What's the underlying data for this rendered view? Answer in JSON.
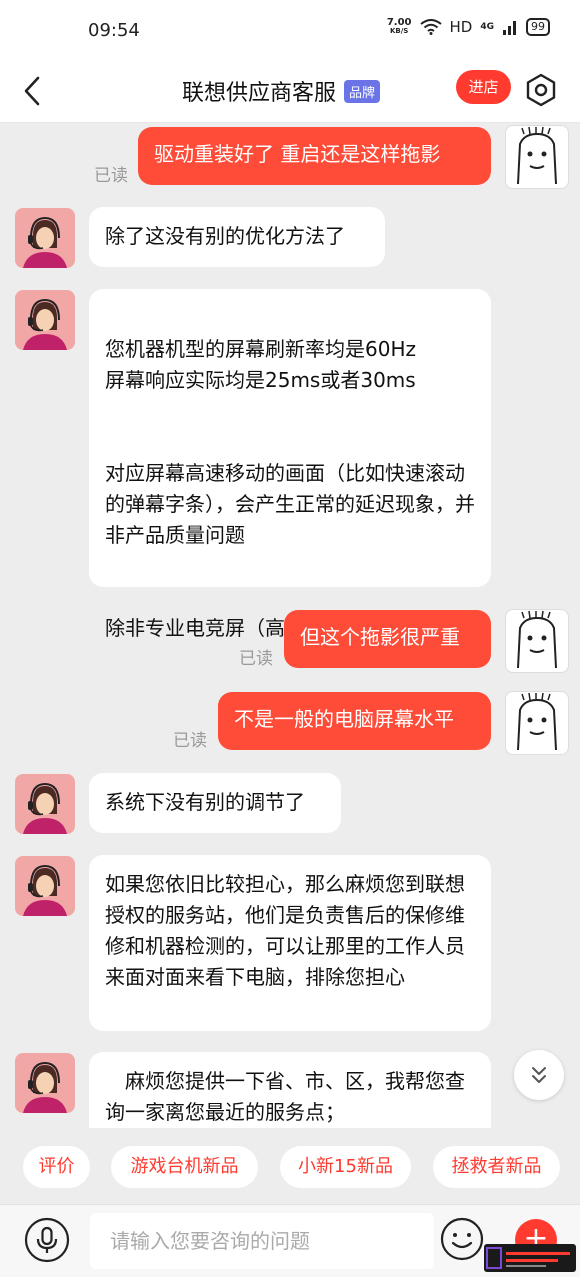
{
  "status_bar": {
    "time": "09:54",
    "net_speed_value": "7.00",
    "net_speed_unit": "KB/S",
    "hd_label": "HD",
    "network_label": "4G",
    "battery": "99"
  },
  "header": {
    "title": "联想供应商客服",
    "brand_badge": "品牌",
    "shop_button": "进店"
  },
  "messages": [
    {
      "from": "user",
      "text": "驱动重装好了  重启还是这样拖影",
      "read": "已读"
    },
    {
      "from": "agent",
      "paragraphs": [
        "除了这没有别的优化方法了"
      ]
    },
    {
      "from": "agent",
      "paragraphs": [
        "您机器机型的屏幕刷新率均是60Hz\n屏幕响应实际均是25ms或者30ms",
        "对应屏幕高速移动的画面（比如快速滚动的弹幕字条），会产生正常的延迟现象，并非产品质量问题",
        "除非专业电竞屏（高刷新率、低延迟）"
      ]
    },
    {
      "from": "user",
      "text": "但这个拖影很严重",
      "read": "已读"
    },
    {
      "from": "user",
      "text": "不是一般的电脑屏幕水平",
      "read": "已读"
    },
    {
      "from": "agent",
      "paragraphs": [
        "系统下没有别的调节了"
      ]
    },
    {
      "from": "agent",
      "paragraphs": [
        "如果您依旧比较担心，那么麻烦您到联想授权的服务站，他们是负责售后的保修维修和机器检测的，可以让那里的工作人员来面对面来看下电脑，排除您担心"
      ]
    },
    {
      "from": "agent",
      "paragraphs": [
        "　麻烦您提供一下省、市、区，我帮您查询一家离您最近的服务点；"
      ]
    }
  ],
  "quick_replies": [
    "评价",
    "游戏台机新品",
    "小新15新品",
    "拯救者新品"
  ],
  "input": {
    "placeholder": "请输入您要咨询的问题"
  },
  "colors": {
    "accent": "#ff3b30",
    "user_bubble": "#ff4c38",
    "agent_bubble": "#ffffff",
    "chat_background": "#ededed",
    "brand_badge": "#6a74e6"
  },
  "icons": [
    "back-arrow-icon",
    "settings-hexagon-icon",
    "agent-avatar-icon",
    "user-avatar-meme-icon",
    "chevron-double-down-icon",
    "microphone-icon",
    "smiley-icon",
    "plus-icon",
    "wifi-icon",
    "signal-icon"
  ]
}
